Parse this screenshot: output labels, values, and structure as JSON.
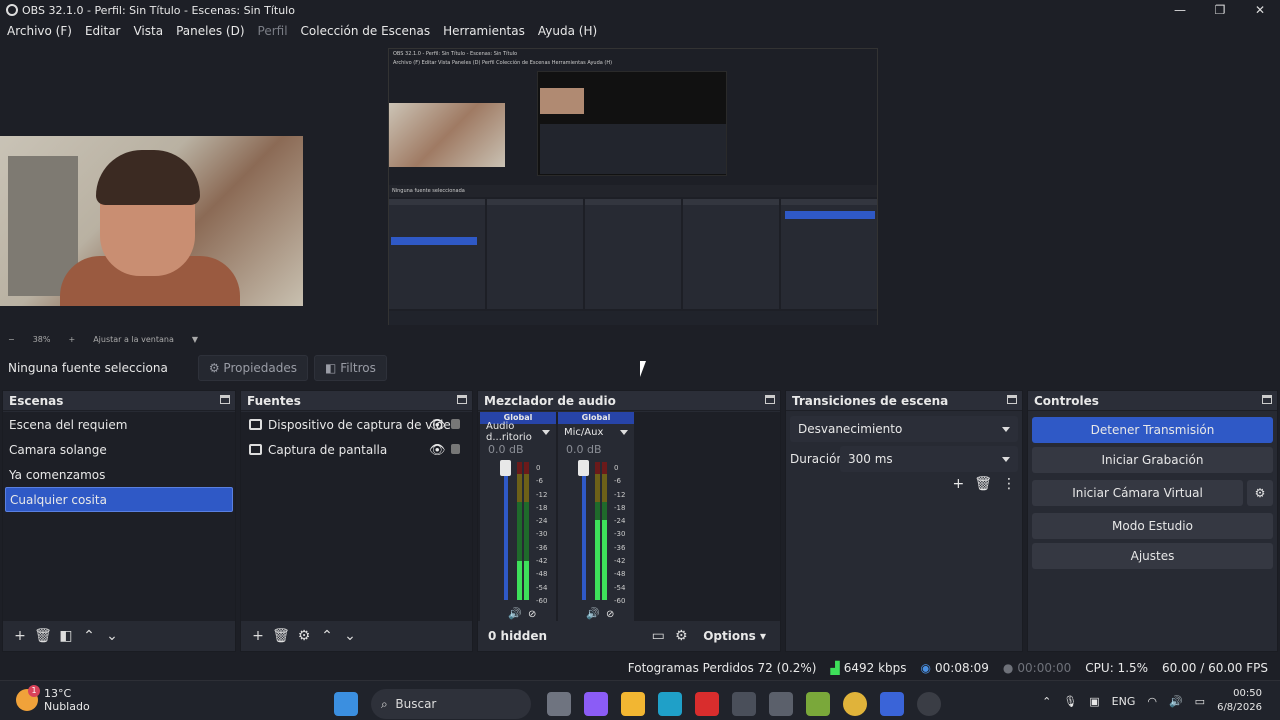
{
  "window": {
    "title": "OBS 32.1.0 - Perfil: Sin Título - Escenas: Sin Título",
    "minimize": "—",
    "maximize": "❐",
    "close": "✕"
  },
  "menu": [
    "Archivo (F)",
    "Editar",
    "Vista",
    "Paneles (D)",
    "Perfil",
    "Colección de Escenas",
    "Herramientas",
    "Ayuda (H)"
  ],
  "zoom": {
    "minus": "−",
    "value": "38%",
    "plus": "+",
    "fit": "Ajustar a la ventana"
  },
  "source_bar": {
    "label": "Ninguna fuente selecciona",
    "properties": "Propiedades",
    "filters": "Filtros"
  },
  "scenes": {
    "title": "Escenas",
    "items": [
      "Escena del requiem",
      "Camara solange",
      "Ya comenzamos",
      "Cualquier cosita"
    ],
    "selected": 3
  },
  "sources": {
    "title": "Fuentes",
    "items": [
      "Dispositivo de captura de video",
      "Captura de pantalla"
    ]
  },
  "mixer": {
    "title": "Mezclador de audio",
    "channels": [
      {
        "badge": "Global",
        "name": "Audio d...ritorio",
        "db": "0.0 dB",
        "level": 0.28
      },
      {
        "badge": "Global",
        "name": "Mic/Aux",
        "db": "0.0 dB",
        "level": 0.58
      }
    ],
    "scale": [
      "0",
      "-6",
      "-12",
      "-18",
      "-24",
      "-30",
      "-36",
      "-42",
      "-48",
      "-54",
      "-60"
    ],
    "hidden": "0 hidden",
    "options": "Options"
  },
  "transitions": {
    "title": "Transiciones de escena",
    "type": "Desvanecimiento",
    "duration_label": "Duración",
    "duration": "300 ms"
  },
  "controls": {
    "title": "Controles",
    "stop_stream": "Detener Transmisión",
    "start_rec": "Iniciar Grabación",
    "start_vcam": "Iniciar Cámara Virtual",
    "studio": "Modo Estudio",
    "settings": "Ajustes"
  },
  "status": {
    "dropped": "Fotogramas Perdidos 72 (0.2%)",
    "bitrate": "6492 kbps",
    "stream_time": "00:08:09",
    "rec_time": "00:00:00",
    "cpu": "CPU: 1.5%",
    "fps": "60.00 / 60.00 FPS"
  },
  "taskbar": {
    "temp": "13°C",
    "weather": "Nublado",
    "badge": "1",
    "search": "Buscar",
    "lang": "ENG",
    "time": "00:50",
    "date": "6/8/2026"
  },
  "nested_preview": {
    "title": "OBS 32.1.0 - Perfil: Sin Título - Escenas: Sin Título",
    "menu": "Archivo (F) Editar Vista Paneles (D) Perfil Colección de Escenas Herramientas Ayuda (H)",
    "bar": "Ninguna fuente seleccionada"
  },
  "colors": {
    "accent": "#2f59c6",
    "panel": "#272a33",
    "background": "#1d1f26"
  }
}
